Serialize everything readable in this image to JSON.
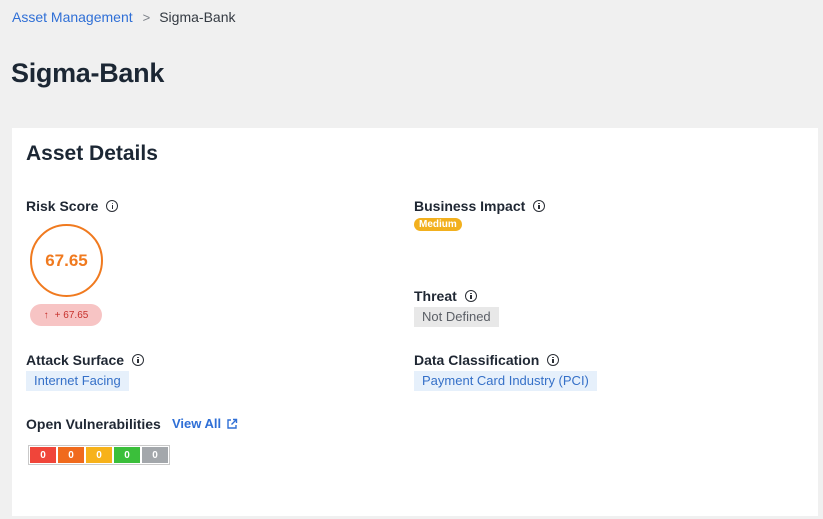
{
  "breadcrumb": {
    "parent": "Asset Management",
    "separator": ">",
    "current": "Sigma-Bank"
  },
  "page": {
    "title": "Sigma-Bank"
  },
  "card": {
    "title": "Asset Details",
    "risk_score": {
      "label": "Risk Score",
      "value": "67.65",
      "delta_arrow": "↑",
      "delta": "+ 67.65"
    },
    "business_impact": {
      "label": "Business Impact",
      "value": "Medium"
    },
    "threat": {
      "label": "Threat",
      "value": "Not Defined"
    },
    "attack_surface": {
      "label": "Attack Surface",
      "value": "Internet Facing"
    },
    "data_classification": {
      "label": "Data Classification",
      "value": "Payment Card Industry (PCI)"
    },
    "open_vulnerabilities": {
      "label": "Open Vulnerabilities",
      "view_all": "View All",
      "counts": [
        {
          "value": "0",
          "color": "#f0453a"
        },
        {
          "value": "0",
          "color": "#f06a1d"
        },
        {
          "value": "0",
          "color": "#f7b21a"
        },
        {
          "value": "0",
          "color": "#3bbf3b"
        },
        {
          "value": "0",
          "color": "#a3a7ab"
        }
      ]
    }
  },
  "colors": {
    "link": "#2f6fd6",
    "risk_orange": "#f07a1f",
    "medium_badge": "#f2b01e"
  }
}
